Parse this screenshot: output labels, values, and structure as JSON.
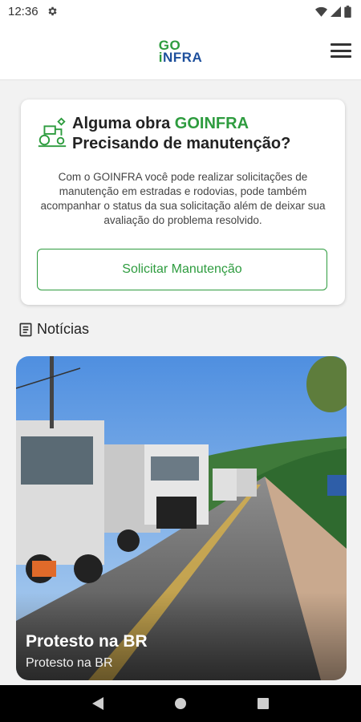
{
  "status_bar": {
    "time": "12:36"
  },
  "header": {
    "logo_line1": "GO",
    "logo_line2_i": "i",
    "logo_line2_rest": "NFRA"
  },
  "card": {
    "title_prefix": "Alguma obra ",
    "title_brand": "GOINFRA",
    "title_line2": "Precisando de manutenção?",
    "description": "Com o GOINFRA você pode realizar solicitações  de manutenção em estradas e rodovias, pode também acompanhar o status da sua solicitação além de deixar sua avaliação do problema resolvido.",
    "button_label": "Solicitar Manutenção"
  },
  "news": {
    "heading": "Notícias",
    "items": [
      {
        "title": "Protesto na BR",
        "subtitle": "Protesto na BR"
      }
    ]
  },
  "icons": {
    "status_left": [
      "gear-icon"
    ],
    "status_right": [
      "wifi-icon",
      "signal-icon",
      "battery-icon"
    ],
    "header": [
      "menu-icon"
    ],
    "card": [
      "tractor-icon"
    ],
    "news": [
      "document-icon"
    ],
    "nav": [
      "back-icon",
      "home-icon",
      "recents-icon"
    ]
  },
  "colors": {
    "brand_green": "#2e9c3f",
    "brand_blue": "#1d4f9c"
  }
}
